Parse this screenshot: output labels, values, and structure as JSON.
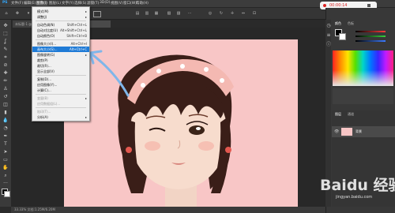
{
  "menubar": {
    "items": [
      "PS",
      "文件(F)",
      "编辑(E)",
      "图像(I)",
      "图层(L)",
      "文字(Y)",
      "选择(S)",
      "滤镜(T)",
      "3D(D)",
      "视图(V)",
      "窗口(W)",
      "帮助(H)"
    ]
  },
  "recording": {
    "time": "00:00:14",
    "stop_icon": "stop-icon"
  },
  "tabs": [
    {
      "label": "未标题-1 @ 33.3% (RGB/8#) ×"
    },
    {
      "label": "图层 1, RGB/8 ×"
    }
  ],
  "image_menu": {
    "items": [
      {
        "label": "模式(M)",
        "shortcut": "",
        "submenu": true,
        "disabled": false,
        "highlighted": false
      },
      {
        "label": "调整(J)",
        "shortcut": "",
        "submenu": true,
        "disabled": false,
        "highlighted": false
      },
      {
        "label": "自动色调(N)",
        "shortcut": "Shift+Ctrl+L",
        "submenu": false,
        "disabled": false,
        "highlighted": false
      },
      {
        "label": "自动对比度(U)",
        "shortcut": "Alt+Shift+Ctrl+L",
        "submenu": false,
        "disabled": false,
        "highlighted": false
      },
      {
        "label": "自动颜色(O)",
        "shortcut": "Shift+Ctrl+B",
        "submenu": false,
        "disabled": false,
        "highlighted": false
      },
      {
        "label": "图像大小(I)...",
        "shortcut": "Alt+Ctrl+I",
        "submenu": false,
        "disabled": false,
        "highlighted": false
      },
      {
        "label": "画布大小(S)...",
        "shortcut": "Alt+Ctrl+C",
        "submenu": false,
        "disabled": false,
        "highlighted": true
      },
      {
        "label": "图像旋转(G)",
        "shortcut": "",
        "submenu": true,
        "disabled": false,
        "highlighted": false
      },
      {
        "label": "裁剪(P)",
        "shortcut": "",
        "submenu": false,
        "disabled": false,
        "highlighted": false
      },
      {
        "label": "裁切(R)...",
        "shortcut": "",
        "submenu": false,
        "disabled": false,
        "highlighted": false
      },
      {
        "label": "显示全部(V)",
        "shortcut": "",
        "submenu": false,
        "disabled": false,
        "highlighted": false
      },
      {
        "label": "复制(D)...",
        "shortcut": "",
        "submenu": false,
        "disabled": false,
        "highlighted": false
      },
      {
        "label": "应用图像(Y)...",
        "shortcut": "",
        "submenu": false,
        "disabled": false,
        "highlighted": false
      },
      {
        "label": "计算(C)...",
        "shortcut": "",
        "submenu": false,
        "disabled": false,
        "highlighted": false
      },
      {
        "label": "变量(B)",
        "shortcut": "",
        "submenu": true,
        "disabled": true,
        "highlighted": false
      },
      {
        "label": "应用数据组(L)...",
        "shortcut": "",
        "submenu": false,
        "disabled": true,
        "highlighted": false
      },
      {
        "label": "陷印(T)...",
        "shortcut": "",
        "submenu": false,
        "disabled": true,
        "highlighted": false
      },
      {
        "label": "分析(A)",
        "shortcut": "",
        "submenu": true,
        "disabled": false,
        "highlighted": false
      }
    ]
  },
  "panels": {
    "color_tab": "颜色",
    "swatches_tab": "色板",
    "layers_tab": "图层",
    "channels_tab": "通道",
    "layer_name": "背景",
    "slider_colors": {
      "r": "#ff3b3b",
      "g": "#36d13b",
      "b": "#3b7bff"
    }
  },
  "status": {
    "text": "33.33%   文档:1.25M/6.20M"
  },
  "watermark": {
    "text": "Baidu 经验",
    "sub": "jingyan.baidu.com"
  },
  "colors": {
    "accent": "#1f7bd6",
    "canvas_bg": "#f8c6c6",
    "arrow": "#7fb6ea"
  }
}
